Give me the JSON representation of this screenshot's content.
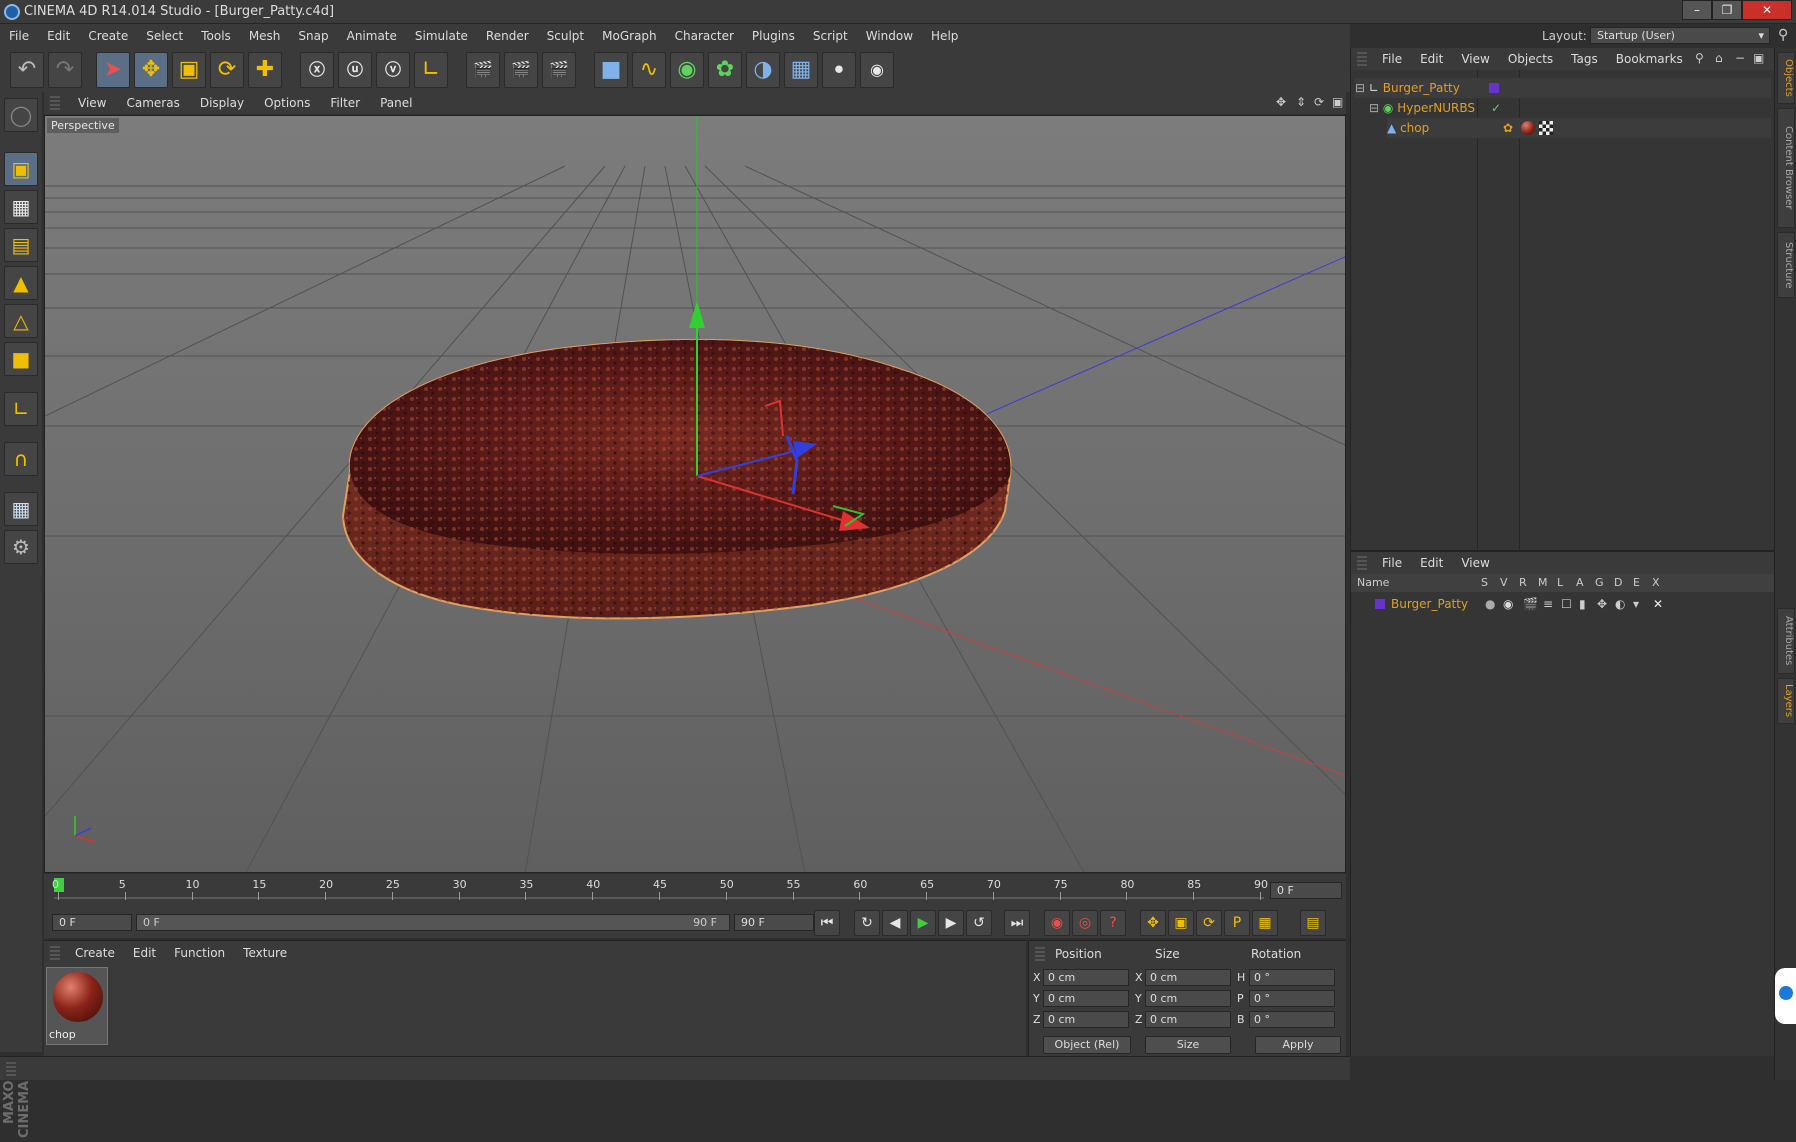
{
  "app": {
    "title": "CINEMA 4D R14.014 Studio - [Burger_Patty.c4d]"
  },
  "menubar": [
    "File",
    "Edit",
    "Create",
    "Select",
    "Tools",
    "Mesh",
    "Snap",
    "Animate",
    "Simulate",
    "Render",
    "Sculpt",
    "MoGraph",
    "Character",
    "Plugins",
    "Script",
    "Window",
    "Help"
  ],
  "layout": {
    "label": "Layout:",
    "value": "Startup (User)"
  },
  "viewport": {
    "menu": [
      "View",
      "Cameras",
      "Display",
      "Options",
      "Filter",
      "Panel"
    ],
    "label": "Perspective",
    "object": "Burger_Patty"
  },
  "timeline": {
    "ticks": [
      "0",
      "5",
      "10",
      "15",
      "20",
      "25",
      "30",
      "35",
      "40",
      "45",
      "50",
      "55",
      "60",
      "65",
      "70",
      "75",
      "80",
      "85",
      "90"
    ],
    "current_frame": "0 F",
    "start": "0 F",
    "range_start": "0 F",
    "range_end": "90 F",
    "end": "90 F"
  },
  "material_panel": {
    "menu": [
      "Create",
      "Edit",
      "Function",
      "Texture"
    ],
    "materials": [
      {
        "name": "chop"
      }
    ]
  },
  "coords": {
    "headers": [
      "Position",
      "Size",
      "Rotation"
    ],
    "rows": [
      {
        "pos_axis": "X",
        "pos": "0 cm",
        "size_axis": "X",
        "size": "0 cm",
        "rot_axis": "H",
        "rot": "0 °"
      },
      {
        "pos_axis": "Y",
        "pos": "0 cm",
        "size_axis": "Y",
        "size": "0 cm",
        "rot_axis": "P",
        "rot": "0 °"
      },
      {
        "pos_axis": "Z",
        "pos": "0 cm",
        "size_axis": "Z",
        "size": "0 cm",
        "rot_axis": "B",
        "rot": "0 °"
      }
    ],
    "mode": "Object (Rel)",
    "size_mode": "Size",
    "apply": "Apply"
  },
  "objects_panel": {
    "menu": [
      "File",
      "Edit",
      "View",
      "Objects",
      "Tags",
      "Bookmarks"
    ],
    "items": [
      {
        "name": "Burger_Patty",
        "level": 0
      },
      {
        "name": "HyperNURBS",
        "level": 1
      },
      {
        "name": "chop",
        "level": 2
      }
    ]
  },
  "layers_panel": {
    "menu": [
      "File",
      "Edit",
      "View"
    ],
    "columns": [
      "Name",
      "S",
      "V",
      "R",
      "M",
      "L",
      "A",
      "G",
      "D",
      "E",
      "X"
    ],
    "items": [
      {
        "name": "Burger_Patty"
      }
    ]
  },
  "right_tabs": [
    "Objects",
    "Content Browser",
    "Structure",
    "Attributes",
    "Layers"
  ],
  "colors": {
    "accent": "#e0a020",
    "layer_color": "#6633cc",
    "selection": "#5a6f86"
  }
}
